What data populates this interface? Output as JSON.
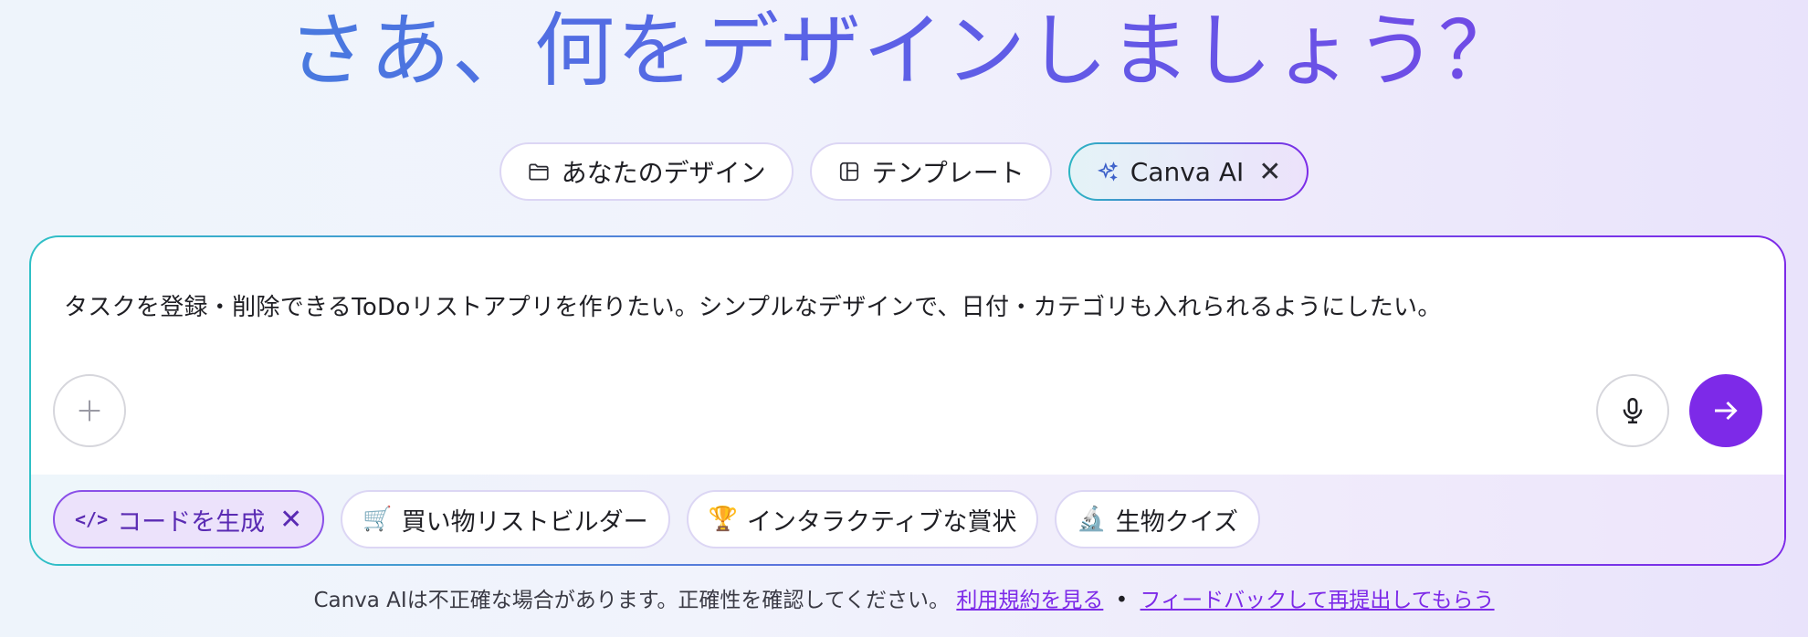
{
  "hero": {
    "title": "さあ、何をデザインしましょう？"
  },
  "tabs": [
    {
      "label": "あなたのデザイン",
      "icon": "folder-icon"
    },
    {
      "label": "テンプレート",
      "icon": "template-icon"
    },
    {
      "label": "Canva AI",
      "icon": "sparkle-icon",
      "active": true
    }
  ],
  "prompt": {
    "text": "タスクを登録・削除できるToDoリストアプリを作りたい。シンプルなデザインで、日付・カテゴリも入れられるようにしたい。"
  },
  "suggestions": [
    {
      "label": "コードを生成",
      "icon": "code-icon",
      "selected": true
    },
    {
      "label": "買い物リストビルダー",
      "emoji": "🛒"
    },
    {
      "label": "インタラクティブな賞状",
      "emoji": "🏆"
    },
    {
      "label": "生物クイズ",
      "emoji": "🔬"
    }
  ],
  "footer": {
    "disclaimer": "Canva AIは不正確な場合があります。正確性を確認してください。",
    "terms_link": "利用規約を見る",
    "separator": "•",
    "feedback_link": "フィードバックして再提出してもらう"
  },
  "colors": {
    "accent": "#7d2ae8",
    "teal": "#2fc0c6"
  }
}
